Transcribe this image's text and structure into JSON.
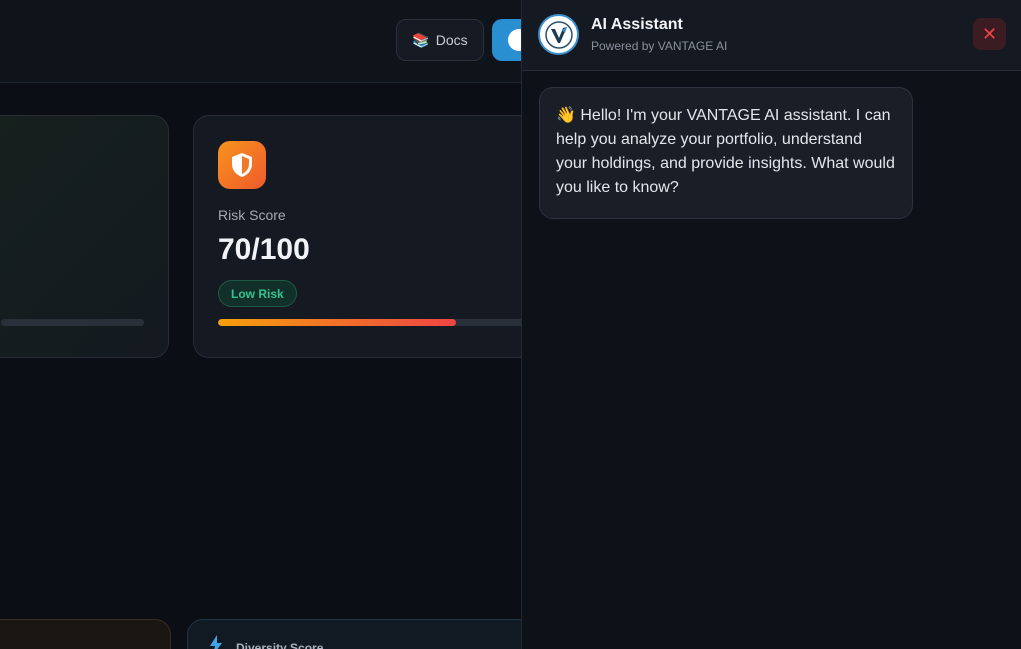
{
  "header": {
    "docs_button": {
      "icon": "books-icon",
      "icon_glyph": "📚",
      "label": "Docs"
    },
    "ai_button": {
      "icon": "vantage-logo-icon"
    }
  },
  "cards": {
    "risk": {
      "label": "Risk Score",
      "value": "70/100",
      "badge": "Low Risk",
      "progress_fraction": 0.7,
      "icon": "shield-icon"
    },
    "diversity": {
      "label": "Diversity Score",
      "icon": "bolt-icon"
    }
  },
  "ai_panel": {
    "title": "AI Assistant",
    "subtitle": "Powered by VANTAGE AI",
    "close_glyph": "✕",
    "messages": [
      {
        "role": "assistant",
        "text": "👋 Hello! I'm your VANTAGE AI assistant. I can help you analyze your portfolio, understand your holdings, and provide insights. What would you like to know?"
      }
    ]
  },
  "colors": {
    "background": "#0b0e14",
    "accent_blue": "#2a8fd0",
    "risk_badge_green": "#34c38f",
    "close_red": "#ef4444"
  }
}
